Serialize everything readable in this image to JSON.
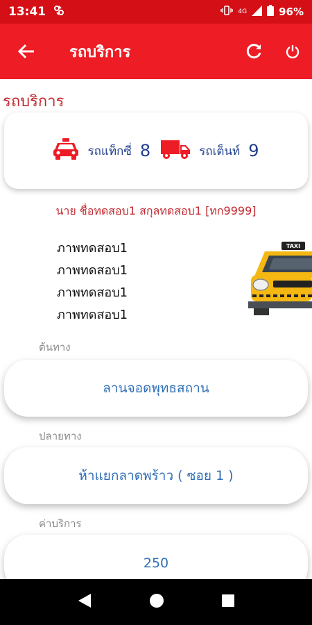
{
  "status": {
    "time": "13:41",
    "network": "4G",
    "battery": "96%"
  },
  "appbar": {
    "title": "รถบริการ"
  },
  "page": {
    "section_title": "รถบริการ"
  },
  "summary": {
    "taxi_label": "รถแท็กซี่",
    "taxi_count": "8",
    "tent_label": "รถเต็นท์",
    "tent_count": "9",
    "taxi_icon_color": "#ee1c25",
    "truck_icon_color": "#ee1c25"
  },
  "driver": {
    "name": "นาย ชื่อทดสอบ1 สกุลทดสอบ1 [ทก9999]"
  },
  "images": [
    "ภาพทดสอบ1",
    "ภาพทดสอบ1",
    "ภาพทดสอบ1",
    "ภาพทดสอบ1"
  ],
  "taxi_sign": "TAXI",
  "fields": {
    "origin_label": "ต้นทาง",
    "origin_value": "ลานจอดพุทธสถาน",
    "destination_label": "ปลายทาง",
    "destination_value": "ห้าแยกลาดพร้าว ( ซอย 1 )",
    "fare_label": "ค่าบริการ",
    "fare_value": "250"
  },
  "colors": {
    "statusbar": "#d40f16",
    "appbar": "#ee1c25",
    "accent_text": "#c0282e",
    "count_text": "#1f3f8c",
    "value_text": "#2f6fb8"
  }
}
